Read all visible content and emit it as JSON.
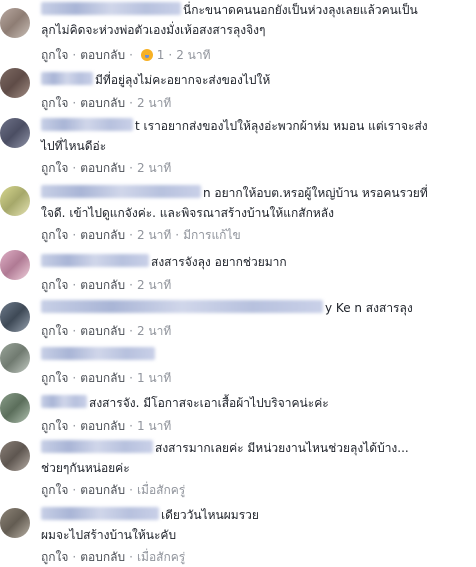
{
  "actions": {
    "like": "ถูกใจ",
    "reply": "ตอบกลับ",
    "sep": "·"
  },
  "comments": [
    {
      "lines": [
        "นี่กะขนาดคนนอกยังเป็นห่วงลุงเลยแล้วคนเป็น",
        "ลุกไม่คิดจะห่วงพ่อตัวเองมั่งเห้อสงสารลุงจิงๆ"
      ],
      "time": "",
      "reaction_count": "1",
      "reaction_time": "2 นาที",
      "edited": ""
    },
    {
      "lines": [
        "มีที่อยู่ลุงไม่คะอยากจะส่งของไปให้"
      ],
      "time": "2 นาที",
      "edited": ""
    },
    {
      "lines": [
        "t เราอยากส่งของไปให้ลุงอ่ะพวกผ้าห่ม หมอน แต่เราจะส่ง",
        "ไปที่ไหนดีอ่ะ"
      ],
      "time": "2 นาที",
      "edited": ""
    },
    {
      "lines": [
        "n อยากให้อบต.หรอผู้ใหญ่บ้าน หรอคนรวยที่",
        "ใจดี. เข้าไปดูแกจังค่ะ. และพิจรณาสร้างบ้านให้แกสักหลัง"
      ],
      "time": "2 นาที",
      "edited": "มีการแก้ไข"
    },
    {
      "lines": [
        "สงสารจังลุง อยากช่วยมาก"
      ],
      "time": "2 นาที",
      "edited": ""
    },
    {
      "lines": [
        "y Ke n สงสารลุง"
      ],
      "time": "2 นาที",
      "edited": ""
    },
    {
      "lines": [
        ""
      ],
      "time": "1 นาที",
      "edited": ""
    },
    {
      "lines": [
        "สงสารจัง. มีโอกาสจะเอาเสื้อผ้าไปบริจาคน่ะค่ะ"
      ],
      "time": "1 นาที",
      "edited": ""
    },
    {
      "lines": [
        "สงสารมากเลยค่ะ มีหน่วยงานไหนช่วยลุงได้บ้าง...",
        "ช่วยๆกันหน่อยค่ะ"
      ],
      "time": "เมื่อสักครู่",
      "edited": ""
    },
    {
      "lines": [
        "เดียววันไหนผมรวย",
        "ผมจะไปสร้างบ้านให้นะคับ"
      ],
      "time": "เมื่อสักครู่",
      "edited": ""
    }
  ],
  "colors": {
    "link": "#4b4f56",
    "meta": "#90949c",
    "text": "#1d2129"
  }
}
